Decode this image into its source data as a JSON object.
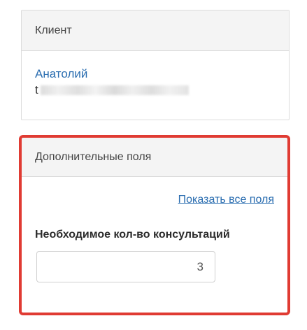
{
  "client_panel": {
    "title": "Клиент",
    "client_name": "Анатолий",
    "phone_prefix": "t"
  },
  "extra_panel": {
    "title": "Дополнительные поля",
    "show_all_link": "Показать все поля",
    "field_label": "Необходимое кол-во консультаций",
    "field_value": "3"
  },
  "colors": {
    "link": "#2a6db0",
    "highlight": "#e03b33",
    "header_bg": "#f4f4f4"
  }
}
